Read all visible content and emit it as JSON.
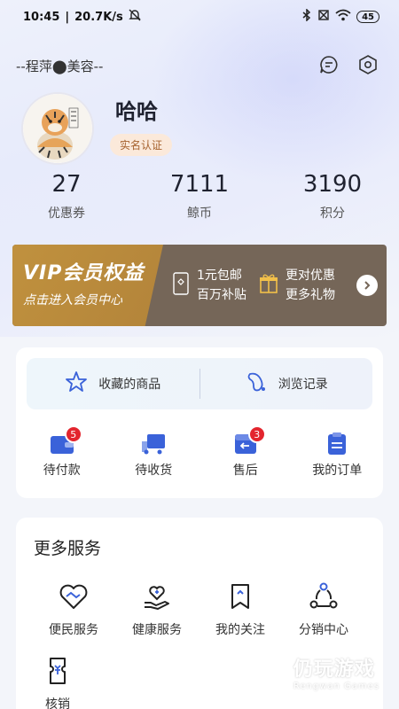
{
  "status_bar": {
    "time": "10:45",
    "speed": "20.7K/s",
    "battery": "45"
  },
  "header": {
    "shop_name": "--程萍⬤美容--",
    "icons": [
      "message-icon",
      "settings-hex-icon"
    ]
  },
  "profile": {
    "username": "哈哈",
    "verify_label": "实名认证"
  },
  "stats": [
    {
      "value": "27",
      "label": "优惠券"
    },
    {
      "value": "7111",
      "label": "鲸币"
    },
    {
      "value": "3190",
      "label": "积分"
    }
  ],
  "vip": {
    "title": "VIP会员权益",
    "subtitle": "点击进入会员中心",
    "perks": [
      {
        "line1": "1元包邮",
        "line2": "百万补贴"
      },
      {
        "line1": "更对优惠",
        "line2": "更多礼物"
      }
    ]
  },
  "quick": {
    "favorites": "收藏的商品",
    "history": "浏览记录"
  },
  "orders": [
    {
      "label": "待付款",
      "badge": "5"
    },
    {
      "label": "待收货",
      "badge": ""
    },
    {
      "label": "售后",
      "badge": "3"
    },
    {
      "label": "我的订单",
      "badge": ""
    }
  ],
  "services": {
    "title": "更多服务",
    "items": [
      {
        "label": "便民服务",
        "icon": "handshake-heart-icon"
      },
      {
        "label": "健康服务",
        "icon": "health-hand-icon"
      },
      {
        "label": "我的关注",
        "icon": "bookmark-icon"
      },
      {
        "label": "分销中心",
        "icon": "share-nodes-icon"
      },
      {
        "label": "核销",
        "icon": "voucher-icon"
      }
    ]
  },
  "watermark": {
    "main": "仍玩游戏",
    "sub": "Rengwan Games"
  },
  "colors": {
    "accent_blue": "#3a62d9",
    "badge_red": "#e3252e",
    "vip_gold": "#c0913e",
    "vip_brown": "#756658"
  }
}
